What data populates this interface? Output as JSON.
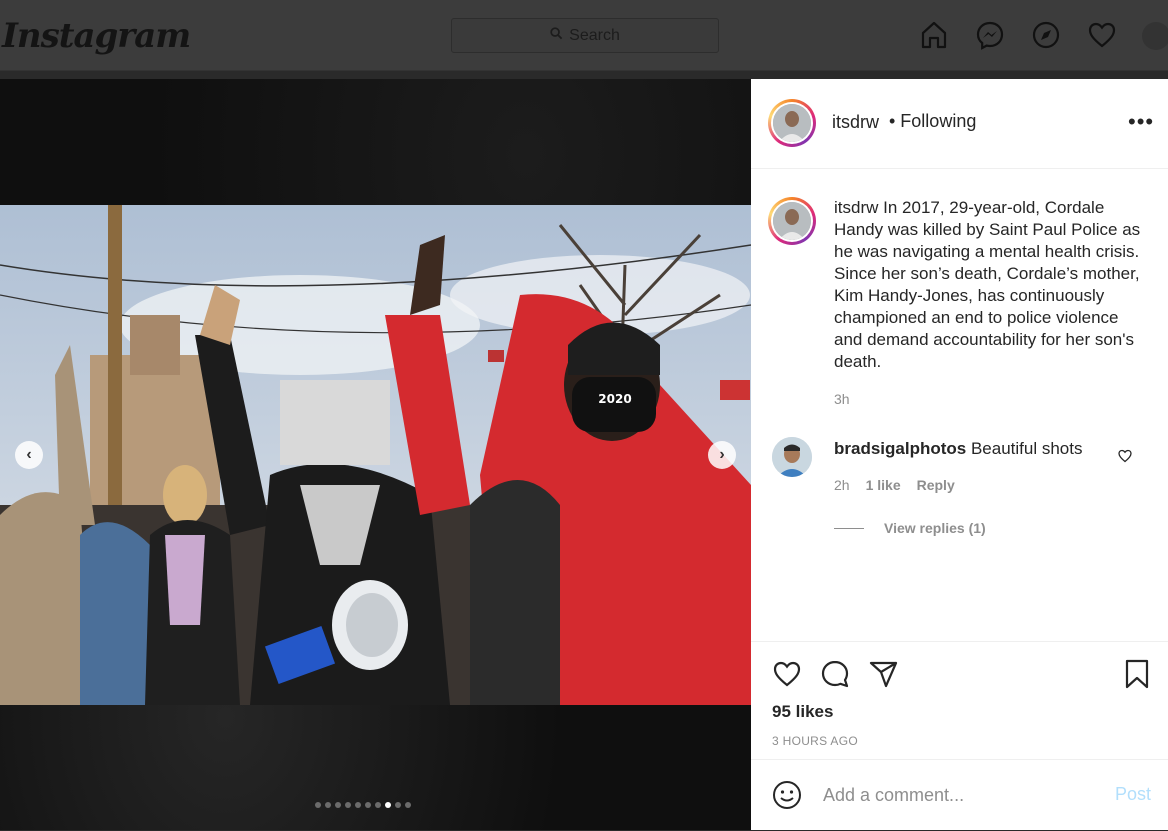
{
  "topbar": {
    "logo": "Instagram",
    "search_placeholder": "Search",
    "icons": [
      "home-icon",
      "messenger-icon",
      "explore-icon",
      "activity-heart-icon",
      "profile-avatar"
    ]
  },
  "media": {
    "carousel_total": 10,
    "carousel_active": 8,
    "photo_mask_text": "2020"
  },
  "post": {
    "header": {
      "username": "itsdrw",
      "follow_status": "• Following",
      "more": "•••"
    },
    "caption": {
      "username": "itsdrw",
      "text": "In 2017, 29-year-old, Cordale Handy was killed by Saint Paul Police as he was navigating a mental health crisis. Since her son’s death, Cordale’s mother, Kim Handy-Jones, has continuously championed an end to police violence and demand accountability for her son's death.",
      "time": "3h"
    },
    "comments": [
      {
        "username": "bradsigalphotos",
        "text": "Beautiful shots",
        "time": "2h",
        "likes": "1 like",
        "reply": "Reply",
        "view_replies": "View replies (1)"
      }
    ],
    "likes": "95 likes",
    "timestamp": "3 HOURS AGO",
    "add_comment_placeholder": "Add a comment...",
    "post_button": "Post"
  },
  "colors": {
    "accent_post": "#b2dffc",
    "text": "#262626",
    "muted": "#8e8e8e",
    "jacket_red": "#d42a2f"
  }
}
